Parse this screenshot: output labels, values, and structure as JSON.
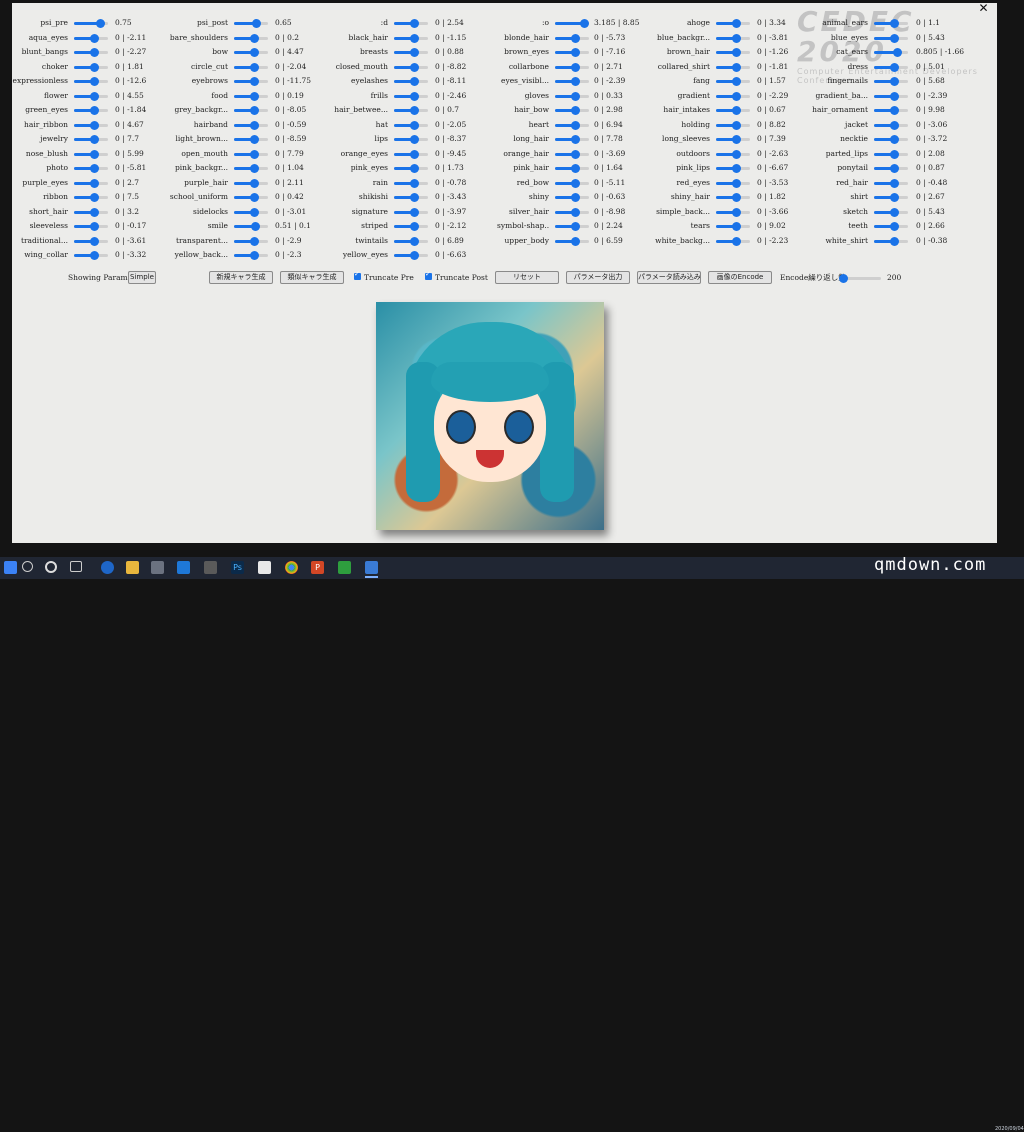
{
  "window": {
    "close_glyph": "✕"
  },
  "logo": {
    "text": "CEDEC 2020",
    "subtitle": "Computer Entertainment Developers Conference"
  },
  "columns": [
    [
      {
        "label": "psi_pre",
        "value": "0.75",
        "pos": 0.75
      },
      {
        "label": "aqua_eyes",
        "value": "0 | -2.11",
        "pos": 0.6
      },
      {
        "label": "blunt_bangs",
        "value": "0 | -2.27",
        "pos": 0.6
      },
      {
        "label": "choker",
        "value": "0 | 1.81",
        "pos": 0.6
      },
      {
        "label": "expressionless",
        "value": "0 | -12.6",
        "pos": 0.6
      },
      {
        "label": "flower",
        "value": "0 | 4.55",
        "pos": 0.6
      },
      {
        "label": "green_eyes",
        "value": "0 | -1.84",
        "pos": 0.6
      },
      {
        "label": "hair_ribbon",
        "value": "0 | 4.67",
        "pos": 0.6
      },
      {
        "label": "jewelry",
        "value": "0 | 7.7",
        "pos": 0.6
      },
      {
        "label": "nose_blush",
        "value": "0 | 5.99",
        "pos": 0.6
      },
      {
        "label": "photo",
        "value": "0 | -5.81",
        "pos": 0.6
      },
      {
        "label": "purple_eyes",
        "value": "0 | 2.7",
        "pos": 0.6
      },
      {
        "label": "ribbon",
        "value": "0 | 7.5",
        "pos": 0.6
      },
      {
        "label": "short_hair",
        "value": "0 | 3.2",
        "pos": 0.6
      },
      {
        "label": "sleeveless",
        "value": "0 | -0.17",
        "pos": 0.6
      },
      {
        "label": "traditional...",
        "value": "0 | -3.61",
        "pos": 0.6
      },
      {
        "label": "wing_collar",
        "value": "0 | -3.32",
        "pos": 0.6
      }
    ],
    [
      {
        "label": "psi_post",
        "value": "0.65",
        "pos": 0.65
      },
      {
        "label": "bare_shoulders",
        "value": "0 | 0.2",
        "pos": 0.6
      },
      {
        "label": "bow",
        "value": "0 | 4.47",
        "pos": 0.6
      },
      {
        "label": "circle_cut",
        "value": "0 | -2.04",
        "pos": 0.6
      },
      {
        "label": "eyebrows",
        "value": "0 | -11.75",
        "pos": 0.6
      },
      {
        "label": "food",
        "value": "0 | 0.19",
        "pos": 0.6
      },
      {
        "label": "grey_backgr...",
        "value": "0 | -8.05",
        "pos": 0.6
      },
      {
        "label": "hairband",
        "value": "0 | -0.59",
        "pos": 0.6
      },
      {
        "label": "light_brown...",
        "value": "0 | -8.59",
        "pos": 0.6
      },
      {
        "label": "open_mouth",
        "value": "0 | 7.79",
        "pos": 0.6
      },
      {
        "label": "pink_backgr...",
        "value": "0 | 1.04",
        "pos": 0.6
      },
      {
        "label": "purple_hair",
        "value": "0 | 2.11",
        "pos": 0.6
      },
      {
        "label": "school_uniform",
        "value": "0 | 0.42",
        "pos": 0.6
      },
      {
        "label": "sidelocks",
        "value": "0 | -3.01",
        "pos": 0.6
      },
      {
        "label": "smile",
        "value": "0.51 | 0.1",
        "pos": 0.62
      },
      {
        "label": "transparent...",
        "value": "0 | -2.9",
        "pos": 0.6
      },
      {
        "label": "yellow_back...",
        "value": "0 | -2.3",
        "pos": 0.6
      }
    ],
    [
      {
        "label": ":d",
        "value": "0 | 2.54",
        "pos": 0.6
      },
      {
        "label": "black_hair",
        "value": "0 | -1.15",
        "pos": 0.6
      },
      {
        "label": "breasts",
        "value": "0 | 0.88",
        "pos": 0.6
      },
      {
        "label": "closed_mouth",
        "value": "0 | -8.82",
        "pos": 0.6
      },
      {
        "label": "eyelashes",
        "value": "0 | -8.11",
        "pos": 0.6
      },
      {
        "label": "frills",
        "value": "0 | -2.46",
        "pos": 0.6
      },
      {
        "label": "hair_betwee...",
        "value": "0 | 0.7",
        "pos": 0.6
      },
      {
        "label": "hat",
        "value": "0 | -2.05",
        "pos": 0.6
      },
      {
        "label": "lips",
        "value": "0 | -8.37",
        "pos": 0.6
      },
      {
        "label": "orange_eyes",
        "value": "0 | -9.45",
        "pos": 0.6
      },
      {
        "label": "pink_eyes",
        "value": "0 | 1.73",
        "pos": 0.6
      },
      {
        "label": "rain",
        "value": "0 | -0.78",
        "pos": 0.6
      },
      {
        "label": "shikishi",
        "value": "0 | -3.43",
        "pos": 0.6
      },
      {
        "label": "signature",
        "value": "0 | -3.97",
        "pos": 0.6
      },
      {
        "label": "striped",
        "value": "0 | -2.12",
        "pos": 0.6
      },
      {
        "label": "twintails",
        "value": "0 | 6.89",
        "pos": 0.6
      },
      {
        "label": "yellow_eyes",
        "value": "0 | -6.63",
        "pos": 0.6
      }
    ],
    [
      {
        "label": ":o",
        "value": "3.185 | 8.85",
        "pos": 0.85
      },
      {
        "label": "blonde_hair",
        "value": "0 | -5.73",
        "pos": 0.6
      },
      {
        "label": "brown_eyes",
        "value": "0 | -7.16",
        "pos": 0.6
      },
      {
        "label": "collarbone",
        "value": "0 | 2.71",
        "pos": 0.6
      },
      {
        "label": "eyes_visibl...",
        "value": "0 | -2.39",
        "pos": 0.6
      },
      {
        "label": "gloves",
        "value": "0 | 0.33",
        "pos": 0.6
      },
      {
        "label": "hair_bow",
        "value": "0 | 2.98",
        "pos": 0.6
      },
      {
        "label": "heart",
        "value": "0 | 6.94",
        "pos": 0.6
      },
      {
        "label": "long_hair",
        "value": "0 | 7.78",
        "pos": 0.6
      },
      {
        "label": "orange_hair",
        "value": "0 | -3.69",
        "pos": 0.6
      },
      {
        "label": "pink_hair",
        "value": "0 | 1.64",
        "pos": 0.6
      },
      {
        "label": "red_bow",
        "value": "0 | -5.11",
        "pos": 0.6
      },
      {
        "label": "shiny",
        "value": "0 | -0.63",
        "pos": 0.6
      },
      {
        "label": "silver_hair",
        "value": "0 | -8.98",
        "pos": 0.6
      },
      {
        "label": "symbol-shap...",
        "value": "0 | 2.24",
        "pos": 0.6
      },
      {
        "label": "upper_body",
        "value": "0 | 6.59",
        "pos": 0.6
      }
    ],
    [
      {
        "label": "ahoge",
        "value": "0 | 3.34",
        "pos": 0.6
      },
      {
        "label": "blue_backgr...",
        "value": "0 | -3.81",
        "pos": 0.6
      },
      {
        "label": "brown_hair",
        "value": "0 | -1.26",
        "pos": 0.6
      },
      {
        "label": "collared_shirt",
        "value": "0 | -1.81",
        "pos": 0.6
      },
      {
        "label": "fang",
        "value": "0 | 1.57",
        "pos": 0.6
      },
      {
        "label": "gradient",
        "value": "0 | -2.29",
        "pos": 0.6
      },
      {
        "label": "hair_intakes",
        "value": "0 | 0.67",
        "pos": 0.6
      },
      {
        "label": "holding",
        "value": "0 | 8.82",
        "pos": 0.6
      },
      {
        "label": "long_sleeves",
        "value": "0 | 7.39",
        "pos": 0.6
      },
      {
        "label": "outdoors",
        "value": "0 | -2.63",
        "pos": 0.6
      },
      {
        "label": "pink_lips",
        "value": "0 | -6.67",
        "pos": 0.6
      },
      {
        "label": "red_eyes",
        "value": "0 | -3.53",
        "pos": 0.6
      },
      {
        "label": "shiny_hair",
        "value": "0 | 1.82",
        "pos": 0.6
      },
      {
        "label": "simple_back...",
        "value": "0 | -3.66",
        "pos": 0.6
      },
      {
        "label": "tears",
        "value": "0 | 9.02",
        "pos": 0.6
      },
      {
        "label": "white_backg...",
        "value": "0 | -2.23",
        "pos": 0.6
      }
    ],
    [
      {
        "label": "animal_ears",
        "value": "0 | 1.1",
        "pos": 0.6
      },
      {
        "label": "blue_eyes",
        "value": "0 | 5.43",
        "pos": 0.6
      },
      {
        "label": "cat_ears",
        "value": "0.805 | -1.66",
        "pos": 0.68
      },
      {
        "label": "dress",
        "value": "0 | 5.01",
        "pos": 0.6
      },
      {
        "label": "fingernails",
        "value": "0 | 5.68",
        "pos": 0.6
      },
      {
        "label": "gradient_ba...",
        "value": "0 | -2.39",
        "pos": 0.6
      },
      {
        "label": "hair_ornament",
        "value": "0 | 9.98",
        "pos": 0.6
      },
      {
        "label": "jacket",
        "value": "0 | -3.06",
        "pos": 0.6
      },
      {
        "label": "necktie",
        "value": "0 | -3.72",
        "pos": 0.6
      },
      {
        "label": "parted_lips",
        "value": "0 | 2.08",
        "pos": 0.6
      },
      {
        "label": "ponytail",
        "value": "0 | 0.87",
        "pos": 0.6
      },
      {
        "label": "red_hair",
        "value": "0 | -0.48",
        "pos": 0.6
      },
      {
        "label": "shirt",
        "value": "0 | 2.67",
        "pos": 0.6
      },
      {
        "label": "sketch",
        "value": "0 | 5.43",
        "pos": 0.6
      },
      {
        "label": "teeth",
        "value": "0 | 2.66",
        "pos": 0.6
      },
      {
        "label": "white_shirt",
        "value": "0 | -0.38",
        "pos": 0.6
      }
    ]
  ],
  "controls": {
    "showing_label": "Showing Parameters",
    "simple_button": "Simple",
    "new_char_button": "新規キャラ生成",
    "similar_char_button": "類似キャラ生成",
    "truncate_pre_label": "Truncate Pre",
    "truncate_pre_checked": true,
    "truncate_post_label": "Truncate Post",
    "truncate_post_checked": true,
    "reset_button": "リセット",
    "param_export_button": "パラメータ出力",
    "param_import_button": "パラメータ読み込み",
    "encode_image_button": "画像のEncode",
    "encode_repeat_label": "Encode繰り返し数",
    "encode_repeat_value": "200",
    "encode_repeat_pos": 0.05
  },
  "taskbar": {
    "icons": [
      "windows-start-icon",
      "search-icon",
      "cortana-icon",
      "task-view-icon",
      "edge-icon",
      "file-explorer-icon",
      "store-icon",
      "mail-icon",
      "app-icon",
      "photoshop-icon",
      "file-icon",
      "chrome-icon",
      "powerpoint-icon",
      "camtasia-icon",
      "app-active-icon"
    ],
    "photoshop_text": "Ps",
    "powerpoint_text": "P"
  },
  "watermark": "qmdown.com",
  "clock_date": "2020/09/04",
  "accent": "#1a73e8"
}
